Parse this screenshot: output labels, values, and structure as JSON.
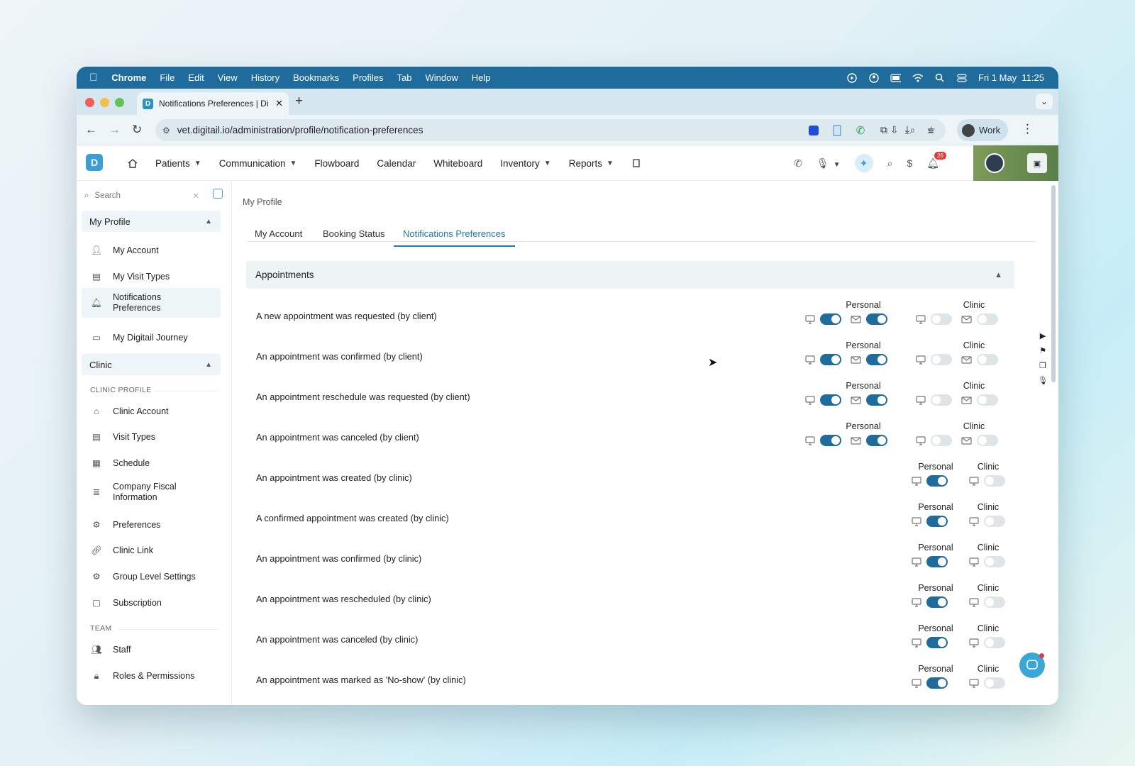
{
  "macos": {
    "app": "Chrome",
    "menus": [
      "File",
      "Edit",
      "View",
      "History",
      "Bookmarks",
      "Profiles",
      "Tab",
      "Window",
      "Help"
    ],
    "datetime": "Fri 1 May  11:25"
  },
  "browser": {
    "tab_title": "Notifications Preferences | Di",
    "url": "vet.digitail.io/administration/profile/notification-preferences",
    "profile": "Work"
  },
  "app_nav": {
    "items": [
      {
        "label": "Patients",
        "dropdown": true
      },
      {
        "label": "Communication",
        "dropdown": true
      },
      {
        "label": "Flowboard",
        "dropdown": false
      },
      {
        "label": "Calendar",
        "dropdown": false
      },
      {
        "label": "Whiteboard",
        "dropdown": false
      },
      {
        "label": "Inventory",
        "dropdown": true
      },
      {
        "label": "Reports",
        "dropdown": true
      }
    ],
    "notification_count": "26"
  },
  "sidebar": {
    "search_placeholder": "Search",
    "my_profile": {
      "title": "My Profile",
      "items": [
        "My Account",
        "My Visit Types",
        "Notifications Preferences",
        "My Digitail Journey"
      ]
    },
    "clinic": {
      "title": "Clinic",
      "clinic_profile_label": "CLINIC PROFILE",
      "items": [
        "Clinic Account",
        "Visit Types",
        "Schedule",
        "Company Fiscal Information",
        "Preferences",
        "Clinic Link",
        "Group Level Settings",
        "Subscription"
      ],
      "team_label": "TEAM",
      "team_items": [
        "Staff",
        "Roles & Permissions"
      ]
    }
  },
  "main": {
    "breadcrumb": "My Profile",
    "tabs": [
      "My Account",
      "Booking Status",
      "Notifications Preferences"
    ],
    "active_tab": "Notifications Preferences",
    "section_title": "Appointments",
    "group_labels": {
      "personal": "Personal",
      "clinic": "Clinic"
    },
    "rows": [
      {
        "label": "A new appointment was requested (by client)",
        "email": true,
        "personal": {
          "app": true,
          "email": true
        },
        "clinic": {
          "app": false,
          "email": false
        }
      },
      {
        "label": "An appointment was confirmed (by client)",
        "email": true,
        "personal": {
          "app": true,
          "email": true
        },
        "clinic": {
          "app": false,
          "email": false
        }
      },
      {
        "label": "An appointment reschedule was requested (by client)",
        "email": true,
        "personal": {
          "app": true,
          "email": true
        },
        "clinic": {
          "app": false,
          "email": false
        }
      },
      {
        "label": "An appointment was canceled (by client)",
        "email": true,
        "personal": {
          "app": true,
          "email": true
        },
        "clinic": {
          "app": false,
          "email": false
        }
      },
      {
        "label": "An appointment was created (by clinic)",
        "email": false,
        "personal": {
          "app": true
        },
        "clinic": {
          "app": false
        }
      },
      {
        "label": "A confirmed appointment was created (by clinic)",
        "email": false,
        "personal": {
          "app": true
        },
        "clinic": {
          "app": false
        }
      },
      {
        "label": "An appointment was confirmed (by clinic)",
        "email": false,
        "personal": {
          "app": true
        },
        "clinic": {
          "app": false
        }
      },
      {
        "label": "An appointment was rescheduled (by clinic)",
        "email": false,
        "personal": {
          "app": true
        },
        "clinic": {
          "app": false
        }
      },
      {
        "label": "An appointment was canceled (by clinic)",
        "email": false,
        "personal": {
          "app": true
        },
        "clinic": {
          "app": false
        }
      },
      {
        "label": "An appointment was marked as 'No-show' (by clinic)",
        "email": false,
        "personal": {
          "app": true
        },
        "clinic": {
          "app": false
        }
      }
    ]
  },
  "colors": {
    "accent": "#1f6c9c",
    "menubar": "#1f6c9c",
    "toggle_off": "#dfe4e8",
    "fab": "#3ba7d7"
  }
}
